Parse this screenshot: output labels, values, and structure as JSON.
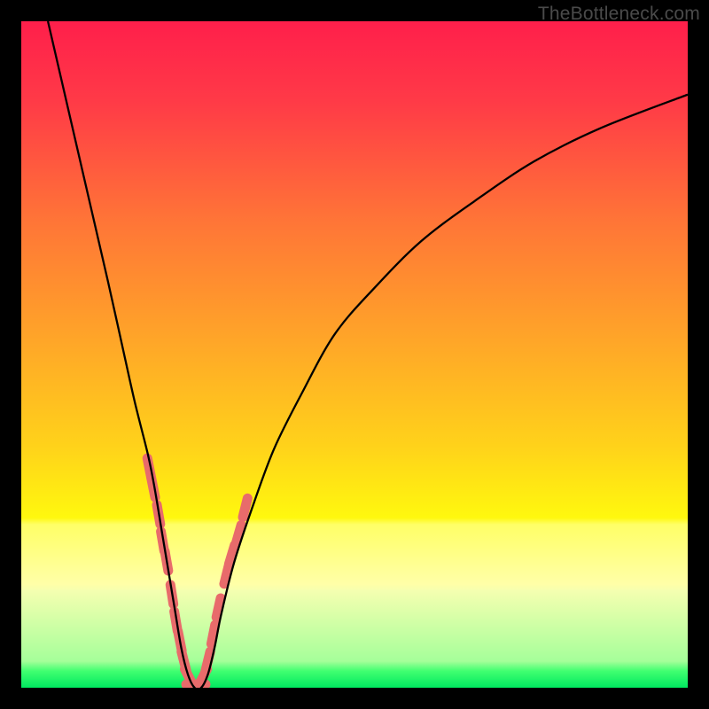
{
  "watermark": "TheBottleneck.com",
  "colors": {
    "frame": "#000000",
    "gradient_stops": [
      {
        "offset": 0.0,
        "color": "#ff1f4b"
      },
      {
        "offset": 0.12,
        "color": "#ff3a47"
      },
      {
        "offset": 0.3,
        "color": "#ff7537"
      },
      {
        "offset": 0.48,
        "color": "#ffa628"
      },
      {
        "offset": 0.64,
        "color": "#ffd31a"
      },
      {
        "offset": 0.745,
        "color": "#fff80e"
      },
      {
        "offset": 0.755,
        "color": "#ffff66"
      },
      {
        "offset": 0.845,
        "color": "#ffffa8"
      },
      {
        "offset": 0.855,
        "color": "#f4ffb0"
      },
      {
        "offset": 0.96,
        "color": "#a6ff9a"
      },
      {
        "offset": 0.975,
        "color": "#40ff70"
      },
      {
        "offset": 1.0,
        "color": "#00e860"
      }
    ],
    "curve": "#000000",
    "accent_spots": "#e86b6b"
  },
  "chart_data": {
    "type": "line",
    "title": "",
    "xlabel": "",
    "ylabel": "",
    "xlim": [
      0,
      100
    ],
    "ylim": [
      0,
      100
    ],
    "grid": false,
    "legend": false,
    "description": "V-shaped bottleneck curve: height ≈ percentage bottleneck, minimum near x≈24–27 at y≈0; steep left branch, gentler right branch.",
    "series": [
      {
        "name": "bottleneck-curve",
        "x": [
          4,
          7,
          10,
          13,
          15,
          17,
          19,
          20,
          21,
          22,
          23,
          24,
          25,
          26,
          27,
          28,
          29,
          30,
          32,
          35,
          38,
          42,
          47,
          53,
          60,
          68,
          77,
          87,
          100
        ],
        "y": [
          100,
          87,
          74,
          61,
          52,
          43,
          35,
          30,
          24,
          18,
          12,
          6,
          2,
          0,
          0,
          2,
          6,
          11,
          19,
          28,
          36,
          44,
          53,
          60,
          67,
          73,
          79,
          84,
          89
        ]
      }
    ],
    "accent_spots": {
      "name": "highlight-dots",
      "points": [
        {
          "x": 19.2,
          "y": 33
        },
        {
          "x": 19.8,
          "y": 30
        },
        {
          "x": 20.6,
          "y": 26
        },
        {
          "x": 21.2,
          "y": 22
        },
        {
          "x": 21.8,
          "y": 19
        },
        {
          "x": 22.6,
          "y": 14
        },
        {
          "x": 23.2,
          "y": 10
        },
        {
          "x": 23.8,
          "y": 7
        },
        {
          "x": 24.4,
          "y": 4
        },
        {
          "x": 25.2,
          "y": 1.5
        },
        {
          "x": 26.2,
          "y": 0.5
        },
        {
          "x": 27.2,
          "y": 1.5
        },
        {
          "x": 28.0,
          "y": 4
        },
        {
          "x": 28.8,
          "y": 8
        },
        {
          "x": 29.6,
          "y": 12
        },
        {
          "x": 30.8,
          "y": 17
        },
        {
          "x": 31.6,
          "y": 20
        },
        {
          "x": 32.6,
          "y": 23
        },
        {
          "x": 33.6,
          "y": 27
        }
      ]
    }
  }
}
